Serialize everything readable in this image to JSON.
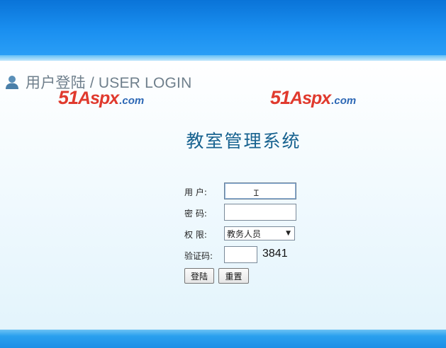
{
  "header": {
    "title": "用户登陆 / USER LOGIN",
    "icon": "user-icon"
  },
  "watermark": {
    "number": "51",
    "name": "Aspx",
    "domain": ".com"
  },
  "system_title": "教室管理系统",
  "form": {
    "username_label": "用 户:",
    "username_value": "",
    "password_label": "密 码:",
    "password_value": "",
    "role_label": "权 限:",
    "role_selected": "教务人员",
    "captcha_label": "验证码:",
    "captcha_value": "",
    "captcha_code": "3841",
    "login_button": "登陆",
    "reset_button": "重置"
  },
  "colors": {
    "banner": "#1a8ff0",
    "title": "#17628f",
    "watermark_red": "#e03a2e",
    "watermark_blue": "#2d68b5"
  }
}
